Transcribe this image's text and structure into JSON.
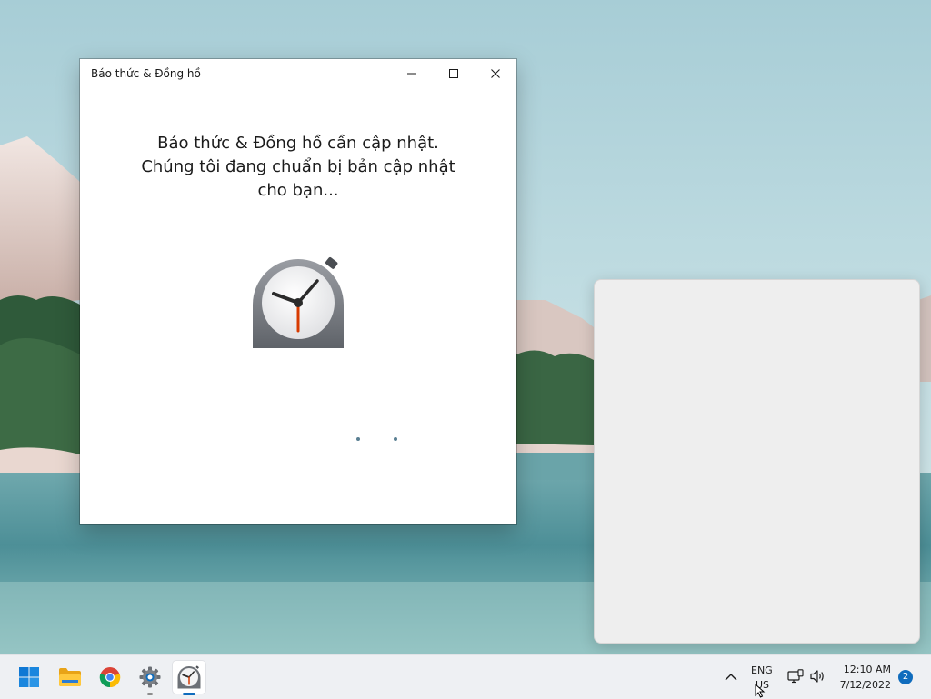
{
  "window": {
    "title": "Báo thức & Đồng hồ",
    "icon": "alarms-clock-icon",
    "controls": [
      "minimize-icon",
      "maximize-icon",
      "close-icon"
    ]
  },
  "main": {
    "message_lines": [
      "Báo thức & Đồng hồ cần cập nhật.",
      "Chúng tôi đang chuẩn bị bản cập nhật",
      "cho bạn..."
    ],
    "progress": "loading-dots"
  },
  "taskbar": {
    "apps": [
      {
        "name": "start",
        "icon": "windows-logo-icon"
      },
      {
        "name": "file-explorer",
        "icon": "folder-icon"
      },
      {
        "name": "chrome",
        "icon": "chrome-icon"
      },
      {
        "name": "settings",
        "icon": "gear-icon",
        "running": true
      },
      {
        "name": "alarms-clock",
        "icon": "alarms-clock-icon",
        "active": true
      }
    ],
    "tray": {
      "chevron": "chevron-up-icon",
      "lang_top": "ENG",
      "lang_bottom": "US",
      "network_icon": "network-icon",
      "volume_icon": "speaker-icon",
      "time": "12:10 AM",
      "date": "7/12/2022",
      "notification_count": "2"
    }
  },
  "colors": {
    "accent": "#0f6cbd",
    "clock_hand_red": "#d83b01",
    "taskbar_bg": "#eef0f3"
  }
}
